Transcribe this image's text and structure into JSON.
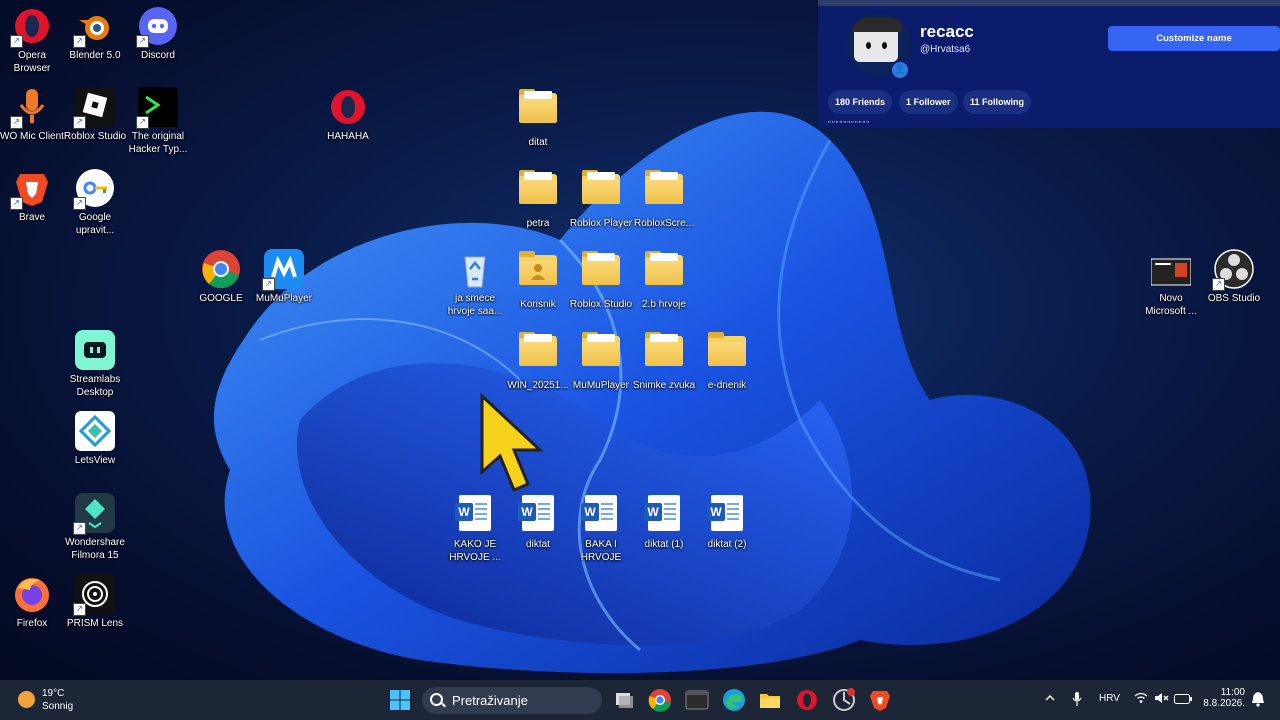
{
  "desktop": {
    "icons": [
      {
        "label": "Opera Browser"
      },
      {
        "label": "Blender 5.0"
      },
      {
        "label": "Discord"
      },
      {
        "label": "WO Mic Client"
      },
      {
        "label": "Roblox Studio"
      },
      {
        "label": "The original Hacker Typ..."
      },
      {
        "label": "HAHAHA"
      },
      {
        "label": "ditat"
      },
      {
        "label": "Brave"
      },
      {
        "label": "Google upravit..."
      },
      {
        "label": "petra"
      },
      {
        "label": "Roblox Player"
      },
      {
        "label": "RobloxScre..."
      },
      {
        "label": "GOOGLE"
      },
      {
        "label": "MuMuPlayer"
      },
      {
        "label": "ja smece hrvoje saa..."
      },
      {
        "label": "Korisnik"
      },
      {
        "label": "Roblox Studio"
      },
      {
        "label": "2.b hrvoje"
      },
      {
        "label": "Novo Microsoft ..."
      },
      {
        "label": "OBS Studio"
      },
      {
        "label": "Streamlabs Desktop"
      },
      {
        "label": "WIN_20251..."
      },
      {
        "label": "MuMuPlayer"
      },
      {
        "label": "Snimke zvuka"
      },
      {
        "label": "e-dnenik"
      },
      {
        "label": "LetsView"
      },
      {
        "label": "Wondershare Filmora 15"
      },
      {
        "label": "KAKO JE HRVOJE ..."
      },
      {
        "label": "diktat"
      },
      {
        "label": "BAKA I HRVOJE"
      },
      {
        "label": "diktat (1)"
      },
      {
        "label": "diktat (2)"
      },
      {
        "label": "Firefox"
      },
      {
        "label": "PRISM Lens"
      }
    ]
  },
  "profile": {
    "username": "recacc",
    "handle": "@Hrvatsa6",
    "customize_label": "Customize name",
    "friends": "180 Friends",
    "followers": "1 Follower",
    "following": "11 Following",
    "dots": "\"\"\"\"\"\"\"\"\"\"\""
  },
  "taskbar": {
    "weather_temp": "19°C",
    "weather_desc": "Sonnig",
    "search_placeholder": "Pretraživanje",
    "language": "HRV",
    "time": "11:00",
    "date": "8.8.2026."
  },
  "colors": {
    "accent": "#3466f2",
    "profile_bg": "#0a1c6b",
    "taskbar_bg": "#1c2637"
  }
}
